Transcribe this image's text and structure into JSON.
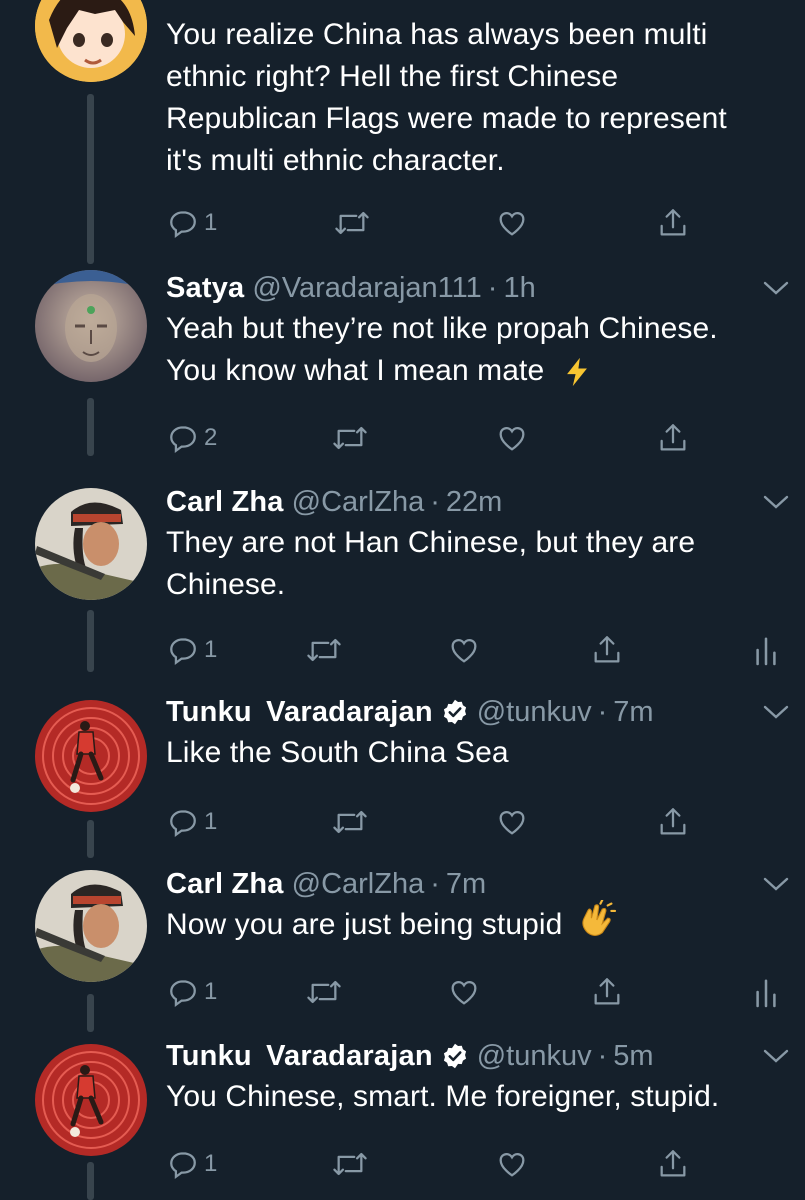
{
  "tweets": [
    {
      "name": "",
      "handle": "",
      "time": "",
      "verified": false,
      "text": "You realize China has always been multi ethnic right? Hell the first Chinese Republican Flags were made to represent it's multi ethnic character.",
      "lines": [
        "You realize China has always been multi",
        "ethnic right? Hell the first Chinese",
        "Republican Flags were made to represent",
        "it's multi ethnic character."
      ],
      "reply_count": "1",
      "avatar": "anime-character-avatar"
    },
    {
      "name": "Satya",
      "handle": "@Varadarajan111",
      "time": "1h",
      "verified": false,
      "lines": [
        "Yeah but they’re not like propah Chinese.",
        "You know what I mean mate"
      ],
      "emoji": "high-voltage-emoji",
      "reply_count": "2",
      "avatar": "stone-face-avatar"
    },
    {
      "name": "Carl Zha",
      "handle": "@CarlZha",
      "time": "22m",
      "verified": false,
      "lines": [
        "They are not Han Chinese, but they are",
        "Chinese."
      ],
      "reply_count": "1",
      "avatar": "woman-with-rifle-avatar"
    },
    {
      "name": "Tunku Varadarajan",
      "handle": "@tunkuv",
      "time": "7m",
      "verified": true,
      "lines": [
        "Like the South China Sea"
      ],
      "reply_count": "1",
      "avatar": "footballer-red-avatar"
    },
    {
      "name": "Carl Zha",
      "handle": "@CarlZha",
      "time": "7m",
      "verified": false,
      "lines": [
        "Now you are just being stupid"
      ],
      "emoji": "clapping-hands-emoji",
      "reply_count": "1",
      "avatar": "woman-with-rifle-avatar"
    },
    {
      "name": "Tunku Varadarajan",
      "handle": "@tunkuv",
      "time": "5m",
      "verified": true,
      "lines": [
        "You Chinese, smart. Me foreigner, stupid."
      ],
      "reply_count": "1",
      "avatar": "footballer-red-avatar"
    }
  ],
  "dot": "·",
  "colors": {
    "background": "#15202b",
    "text": "#ffffff",
    "secondary": "#8899a6",
    "thread_line": "#38444d",
    "verified": "#ffffff"
  }
}
